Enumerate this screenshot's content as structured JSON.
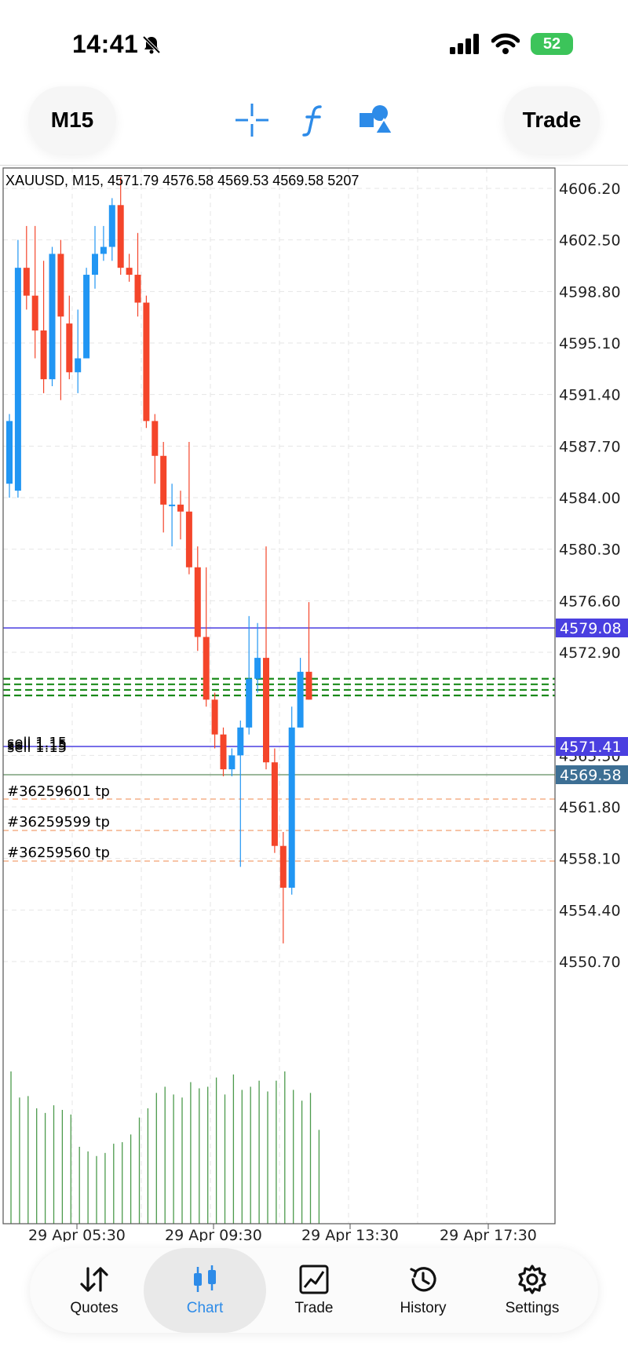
{
  "status": {
    "time": "14:41",
    "battery": "52"
  },
  "toolbar": {
    "timeframe": "M15",
    "trade_label": "Trade"
  },
  "chart_info": "XAUUSD, M15, 4571.79 4576.58 4569.53 4569.58 5207",
  "price_axis": [
    "4606.20",
    "4602.50",
    "4598.80",
    "4595.10",
    "4591.40",
    "4587.70",
    "4584.00",
    "4580.30",
    "4576.60",
    "4572.90",
    "4565.50",
    "4561.80",
    "4558.10",
    "4554.40",
    "4550.70"
  ],
  "time_axis": [
    "29 Apr 05:30",
    "29 Apr 09:30",
    "29 Apr 13:30",
    "29 Apr 17:30"
  ],
  "price_lines": {
    "upper": "4579.08",
    "middle": "4571.41",
    "bid": "4569.58"
  },
  "orders": {
    "sell_label": "sell 1.15",
    "tp_labels": [
      "#36259601 tp",
      "#36259599 tp",
      "#36259560 tp"
    ]
  },
  "nav": {
    "items": [
      {
        "label": "Quotes"
      },
      {
        "label": "Chart"
      },
      {
        "label": "Trade"
      },
      {
        "label": "History"
      },
      {
        "label": "Settings"
      }
    ]
  },
  "colors": {
    "bull": "#2196f3",
    "bear": "#f4452a",
    "volume": "#4c9a4c",
    "accent": "#2d8be8",
    "line_blue": "#4a3fe0",
    "bid_bg": "#3d6f94"
  },
  "chart_data": {
    "type": "candlestick",
    "symbol": "XAUUSD",
    "timeframe": "M15",
    "ylim": [
      4548,
      4608
    ],
    "candles": [
      {
        "o": 4585.0,
        "h": 4590.0,
        "c": 4589.5,
        "l": 4584.0
      },
      {
        "o": 4584.5,
        "h": 4602.5,
        "c": 4600.5,
        "l": 4584.0
      },
      {
        "o": 4600.5,
        "h": 4603.5,
        "c": 4598.5,
        "l": 4597.5
      },
      {
        "o": 4598.5,
        "h": 4603.5,
        "c": 4596.0,
        "l": 4594.0
      },
      {
        "o": 4596.0,
        "h": 4601.0,
        "c": 4592.5,
        "l": 4591.5
      },
      {
        "o": 4592.5,
        "h": 4602.0,
        "c": 4601.5,
        "l": 4592.0
      },
      {
        "o": 4601.5,
        "h": 4602.5,
        "c": 4597.0,
        "l": 4591.0
      },
      {
        "o": 4596.5,
        "h": 4598.5,
        "c": 4593.0,
        "l": 4592.5
      },
      {
        "o": 4593.0,
        "h": 4597.5,
        "c": 4594.0,
        "l": 4591.5
      },
      {
        "o": 4594.0,
        "h": 4600.5,
        "c": 4600.0,
        "l": 4594.0
      },
      {
        "o": 4600.0,
        "h": 4603.5,
        "c": 4601.5,
        "l": 4599.0
      },
      {
        "o": 4601.5,
        "h": 4603.5,
        "c": 4602.0,
        "l": 4601.0
      },
      {
        "o": 4602.0,
        "h": 4605.5,
        "c": 4605.0,
        "l": 4601.0
      },
      {
        "o": 4605.0,
        "h": 4607.0,
        "c": 4600.5,
        "l": 4600.0
      },
      {
        "o": 4600.5,
        "h": 4601.5,
        "c": 4600.0,
        "l": 4599.5
      },
      {
        "o": 4600.0,
        "h": 4603.0,
        "c": 4598.0,
        "l": 4597.0
      },
      {
        "o": 4598.0,
        "h": 4598.5,
        "c": 4589.5,
        "l": 4589.0
      },
      {
        "o": 4589.5,
        "h": 4590.0,
        "c": 4587.0,
        "l": 4585.0
      },
      {
        "o": 4587.0,
        "h": 4588.0,
        "c": 4583.5,
        "l": 4581.5
      },
      {
        "o": 4583.5,
        "h": 4585.0,
        "c": 4583.5,
        "l": 4580.5
      },
      {
        "o": 4583.5,
        "h": 4584.5,
        "c": 4583.0,
        "l": 4581.0
      },
      {
        "o": 4583.0,
        "h": 4588.0,
        "c": 4579.0,
        "l": 4578.5
      },
      {
        "o": 4579.0,
        "h": 4580.5,
        "c": 4574.0,
        "l": 4573.0
      },
      {
        "o": 4574.0,
        "h": 4579.0,
        "c": 4569.5,
        "l": 4569.0
      },
      {
        "o": 4569.5,
        "h": 4570.0,
        "c": 4567.0,
        "l": 4566.0
      },
      {
        "o": 4567.0,
        "h": 4567.5,
        "c": 4564.5,
        "l": 4564.0
      },
      {
        "o": 4564.5,
        "h": 4566.0,
        "c": 4565.5,
        "l": 4564.0
      },
      {
        "o": 4565.5,
        "h": 4568.0,
        "c": 4567.5,
        "l": 4557.5
      },
      {
        "o": 4567.5,
        "h": 4575.5,
        "c": 4571.0,
        "l": 4567.0
      },
      {
        "o": 4571.0,
        "h": 4575.0,
        "c": 4572.5,
        "l": 4570.0
      },
      {
        "o": 4572.5,
        "h": 4580.5,
        "c": 4565.0,
        "l": 4564.5
      },
      {
        "o": 4565.0,
        "h": 4566.0,
        "c": 4559.0,
        "l": 4558.5
      },
      {
        "o": 4559.0,
        "h": 4560.0,
        "c": 4556.0,
        "l": 4552.0
      },
      {
        "o": 4556.0,
        "h": 4569.0,
        "c": 4567.5,
        "l": 4555.5
      },
      {
        "o": 4567.5,
        "h": 4572.5,
        "c": 4571.5,
        "l": 4567.5
      },
      {
        "o": 4571.5,
        "h": 4576.5,
        "c": 4569.5,
        "l": 4569.5
      }
    ],
    "volumes": [
      0.99,
      0.82,
      0.83,
      0.75,
      0.72,
      0.77,
      0.74,
      0.71,
      0.5,
      0.47,
      0.44,
      0.46,
      0.52,
      0.53,
      0.58,
      0.69,
      0.75,
      0.85,
      0.89,
      0.84,
      0.82,
      0.92,
      0.88,
      0.89,
      0.95,
      0.84,
      0.97,
      0.87,
      0.89,
      0.93,
      0.86,
      0.93,
      0.99,
      0.87,
      0.8,
      0.85,
      0.61
    ],
    "price_lines": [
      4579.08,
      4571.41,
      4569.58
    ],
    "tp_levels": [
      4566.8,
      4565.7,
      4564.6
    ],
    "sl_levels": [
      4571.0,
      4570.6,
      4570.2,
      4569.8
    ]
  }
}
